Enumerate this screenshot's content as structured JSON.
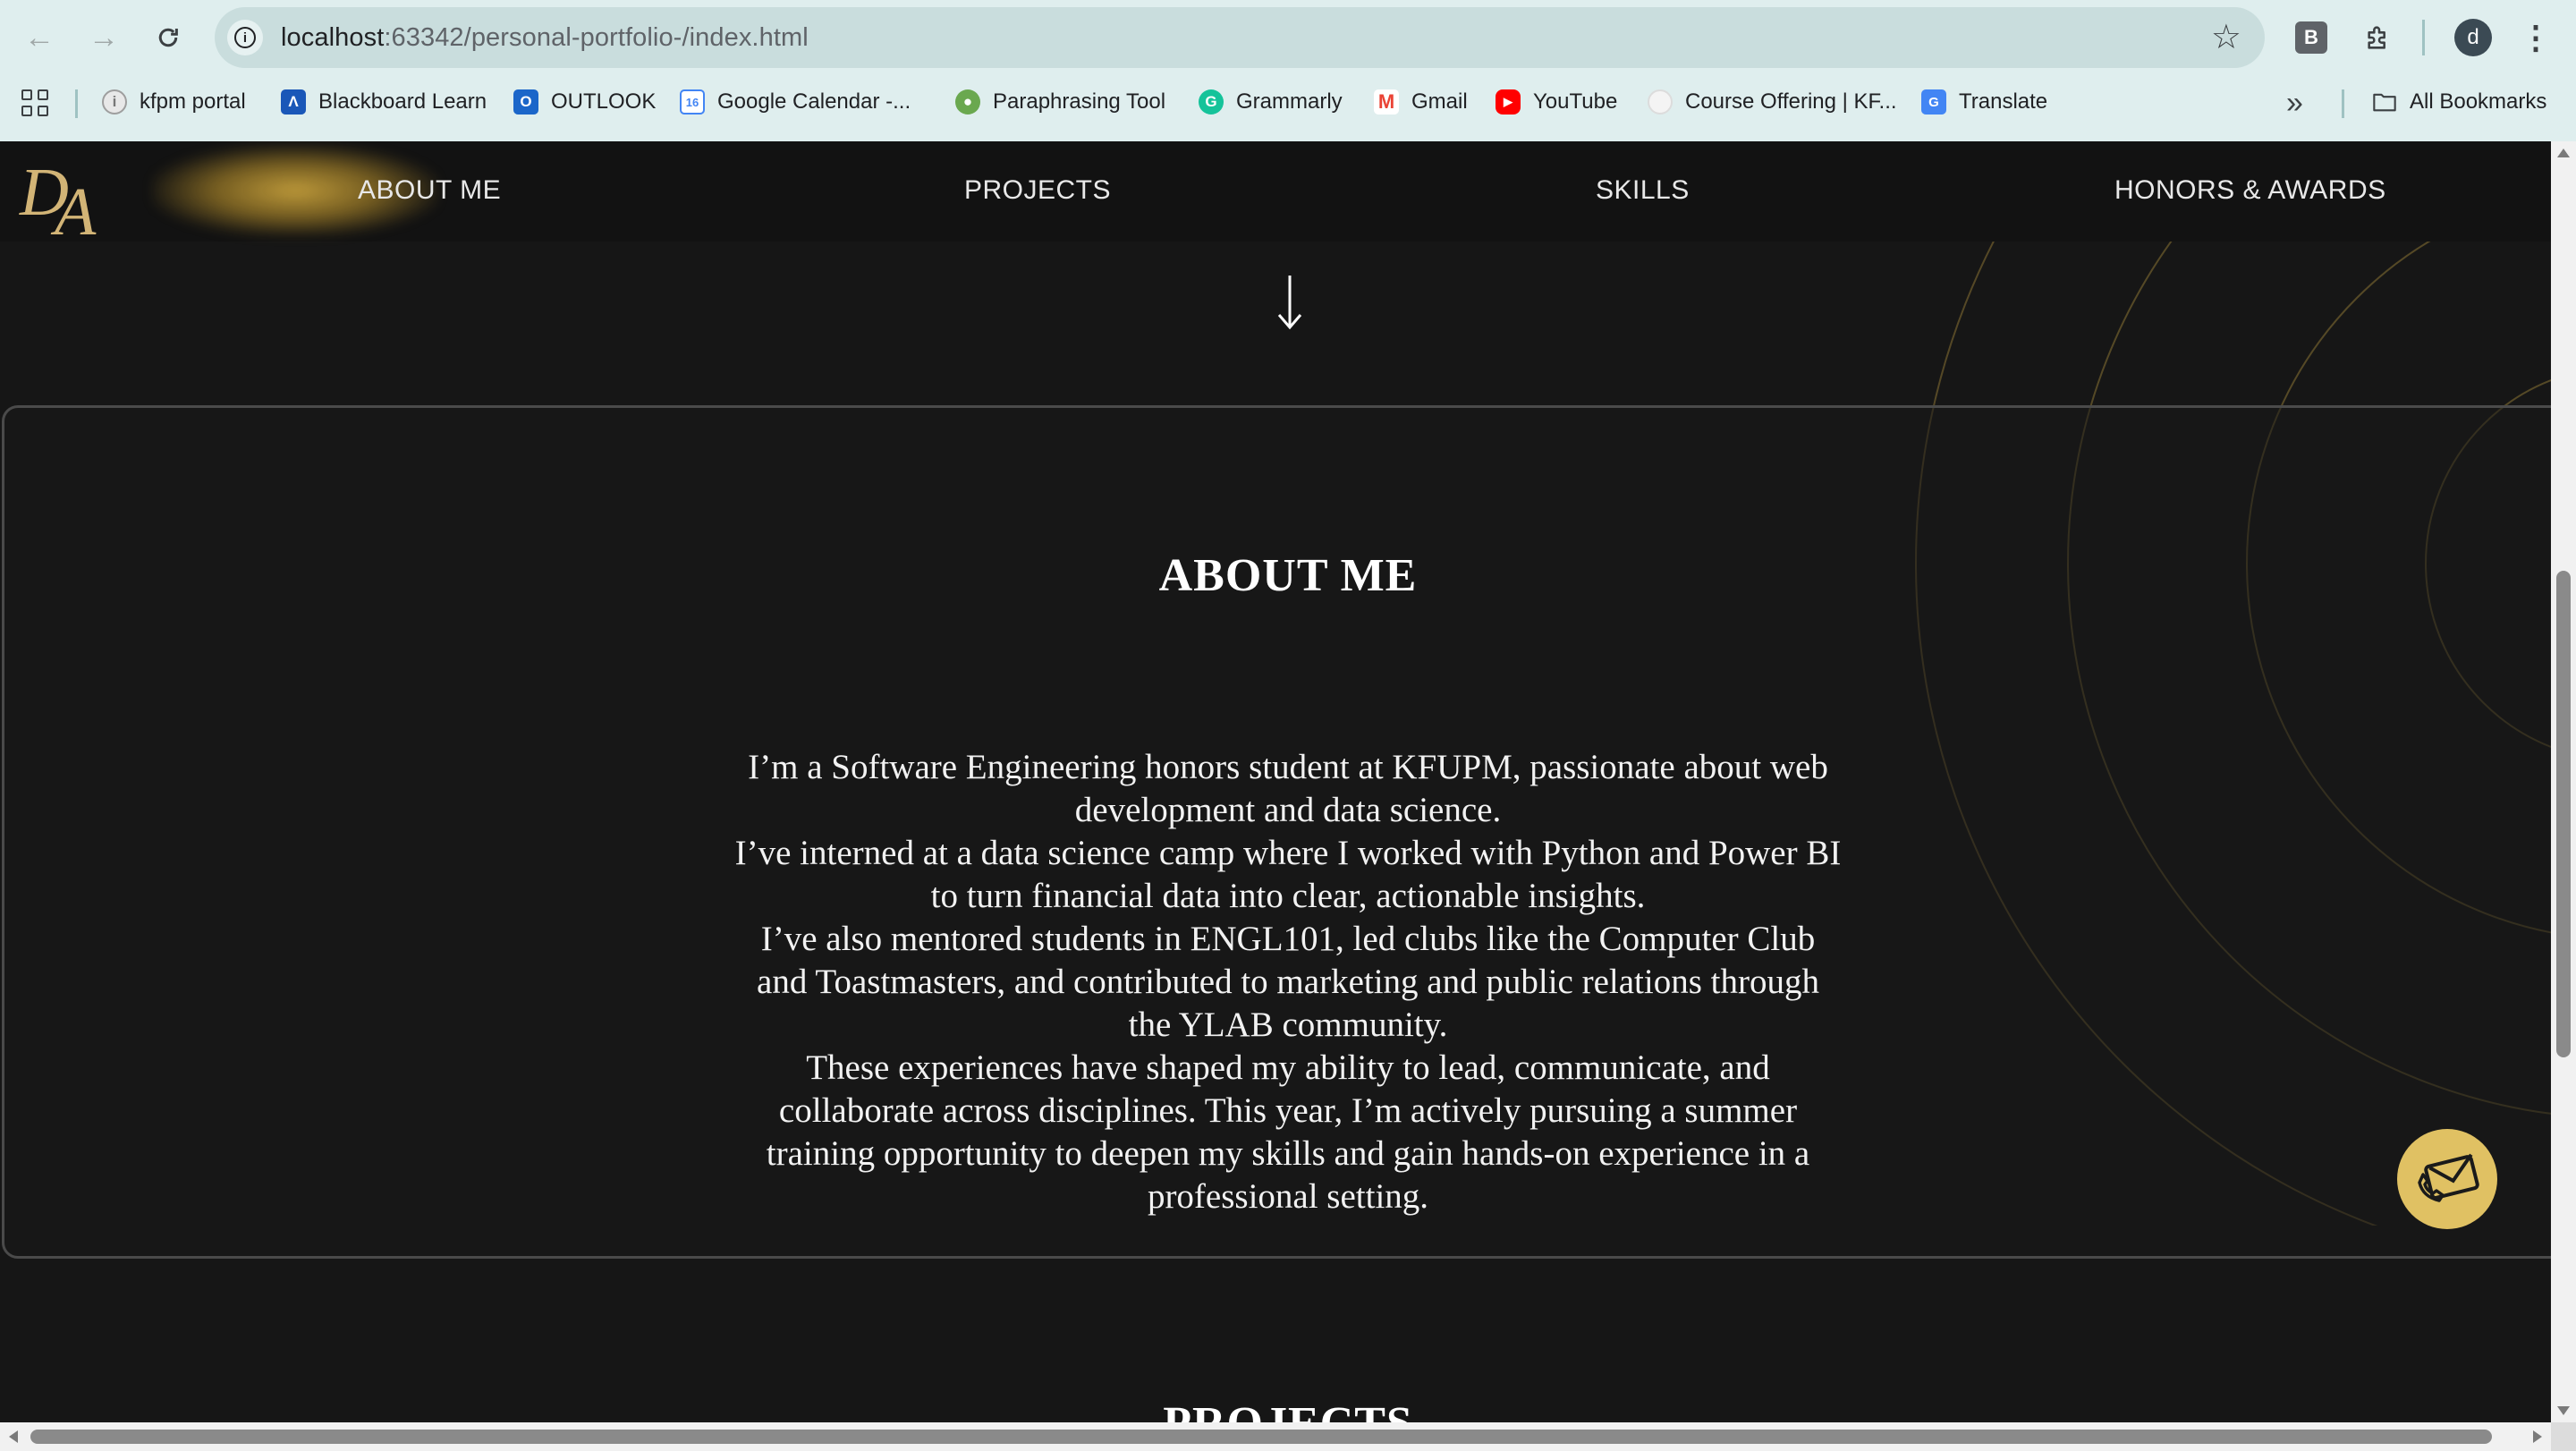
{
  "browser": {
    "url_host": "localhost",
    "url_rest": ":63342/personal-portfolio-/index.html",
    "profile_initial": "d",
    "extension_label": "B",
    "bookmarks": [
      {
        "label": "kfpm portal",
        "icon": "kfpm-icon",
        "color": "#9e9e9e"
      },
      {
        "label": "Blackboard Learn",
        "icon": "blackboard-icon",
        "color": "#1a57b8"
      },
      {
        "label": "OUTLOOK",
        "icon": "outlook-icon",
        "color": "#1b66c9"
      },
      {
        "label": "Google Calendar -...",
        "icon": "google-calendar-icon",
        "color": "#4285f4"
      },
      {
        "label": "Paraphrasing Tool",
        "icon": "paraphrasing-icon",
        "color": "#4caf50"
      },
      {
        "label": "Grammarly",
        "icon": "grammarly-icon",
        "color": "#15c39a"
      },
      {
        "label": "Gmail",
        "icon": "gmail-icon",
        "color": "#ea4335"
      },
      {
        "label": "YouTube",
        "icon": "youtube-icon",
        "color": "#ff0000"
      },
      {
        "label": "Course Offering | KF...",
        "icon": "course-offering-icon",
        "color": "#cfcfcf"
      },
      {
        "label": "Translate",
        "icon": "translate-icon",
        "color": "#4285f4"
      }
    ],
    "all_bookmarks": "All Bookmarks"
  },
  "site": {
    "logo": {
      "d": "D",
      "a": "A"
    },
    "nav": [
      "ABOUT ME",
      "PROJECTS",
      "SKILLS",
      "HONORS & AWARDS"
    ],
    "about": {
      "title": "ABOUT ME",
      "paragraphs": [
        "I’m a Software Engineering honors student at KFUPM, passionate about web development and data science.",
        "I’ve interned at a data science camp where I worked with Python and Power BI to turn financial data into clear, actionable insights.",
        "I’ve also mentored students in ENGL101, led clubs like the Computer Club and Toastmasters, and contributed to marketing and public relations through the YLAB community.",
        "These experiences have shaped my ability to lead, communicate, and collaborate across disciplines. This year, I’m actively pursuing a summer training opportunity to deepen my skills and gain hands-on experience in a professional setting."
      ]
    },
    "next_section_title": "PROJECTS",
    "colors": {
      "background": "#161616",
      "accent_gold": "#d2b476",
      "fab": "#e0c163"
    }
  }
}
